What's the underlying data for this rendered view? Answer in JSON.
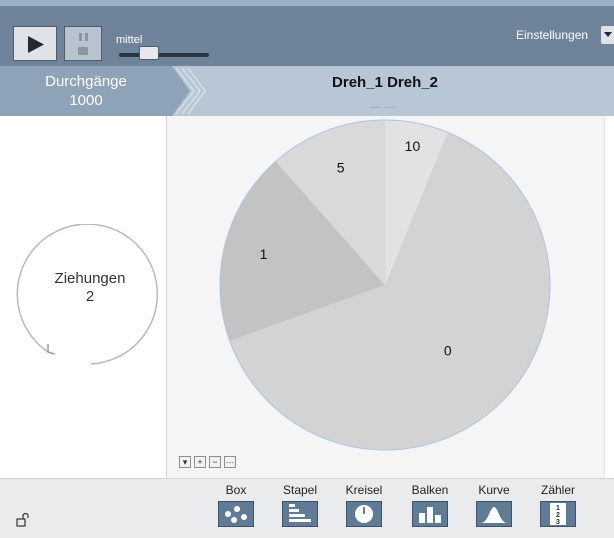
{
  "toolbar": {
    "speed_label": "mittel",
    "speed_level": 0.33,
    "settings_label": "Einstellungen"
  },
  "header": {
    "runs_label": "Durchgänge",
    "runs_value": "1000",
    "title": "Dreh_1 Dreh_2",
    "title_marks": "— —"
  },
  "left": {
    "draws_label": "Ziehungen",
    "draws_value": "2"
  },
  "chart_data": {
    "type": "pie",
    "categories": [
      "10",
      "0",
      "1",
      "5"
    ],
    "values": [
      6.2,
      63.3,
      19.0,
      11.5
    ],
    "colors": [
      "#e2e2e2",
      "#d3d3d3",
      "#c3c3c3",
      "#d9d9d9"
    ]
  },
  "zoom": {
    "down": "▾",
    "plus": "+",
    "minus": "−",
    "fit": "···"
  },
  "devices": [
    {
      "label": "Box",
      "icon": "box-icon"
    },
    {
      "label": "Stapel",
      "icon": "stack-icon"
    },
    {
      "label": "Kreisel",
      "icon": "spinner-icon"
    },
    {
      "label": "Balken",
      "icon": "bars-icon"
    },
    {
      "label": "Kurve",
      "icon": "curve-icon"
    },
    {
      "label": "Zähler",
      "icon": "counter-icon"
    }
  ],
  "counter_icon_digits": [
    "1",
    "2",
    "3"
  ]
}
